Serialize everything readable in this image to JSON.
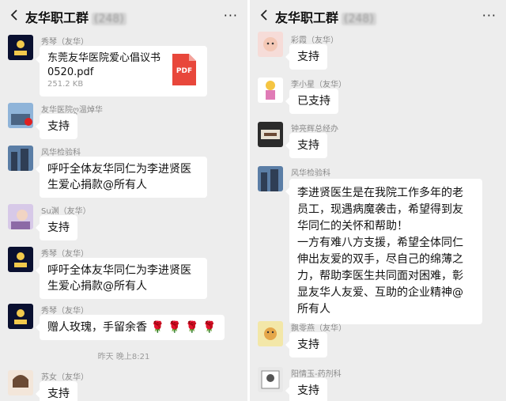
{
  "left": {
    "title": "友华职工群",
    "member_count": "(248)",
    "more": "···",
    "file_msg": {
      "sender": "秀琴（友华）",
      "file_name": "东莞友华医院爱心倡议书0520.pdf",
      "file_size": "251.2 KB",
      "file_type": "PDF"
    },
    "msg2": {
      "sender": "友华医院ღ温焯华",
      "text": "支持"
    },
    "msg3": {
      "sender": "风华检验科",
      "text": "呼吁全体友华同仁为李进贤医生爱心捐款@所有人"
    },
    "msg4": {
      "sender": "Su渊（友华）",
      "text": "支持"
    },
    "msg5": {
      "sender": "秀琴（友华）",
      "text": "呼吁全体友华同仁为李进贤医生爱心捐款@所有人"
    },
    "msg6": {
      "sender": "秀琴（友华）",
      "text": "赠人玫瑰，手留余香",
      "roses": "🌹 🌹 🌹 🌹"
    },
    "timestamp": "昨天 晚上8:21",
    "msg7": {
      "sender": "苏女（友华）",
      "text": "支持"
    }
  },
  "right": {
    "title": "友华职工群",
    "member_count": "(248)",
    "more": "···",
    "msg1": {
      "sender": "彩霞（友华）",
      "text": "支持"
    },
    "msg2": {
      "sender": "李小星（友华）",
      "text": "已支持"
    },
    "msg3": {
      "sender": "钟亮辉总经办",
      "text": "支持"
    },
    "msg4": {
      "sender": "风华检验科",
      "lines": [
        "李进贤医生是在我院工作多年的老",
        "员工，现遇病魔袭击，希望得到友",
        "华同仁的关怀和帮助！",
        "一方有难八方支援，希望全体同仁",
        "伸出友爱的双手，尽自己的绵薄之",
        "力，帮助李医生共同面对困难，彰",
        "显友华人友爱、互助的企业精神@",
        "所有人"
      ]
    },
    "msg5": {
      "sender": "飘零燕（友华）",
      "text": "支持"
    },
    "msg6": {
      "sender": "阳情玉-药剂科",
      "text": "支持"
    }
  },
  "colors": {
    "background": "#ededed",
    "bubble": "#ffffff",
    "pdf_red": "#e8473b",
    "sender_gray": "#8a8a8a"
  },
  "icons": [
    "back-arrow-icon",
    "more-dots-icon",
    "pdf-file-icon",
    "rose-emoji"
  ]
}
